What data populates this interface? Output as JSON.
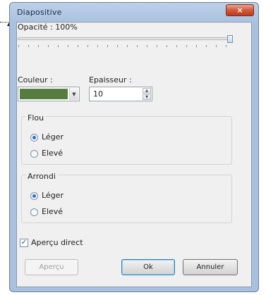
{
  "window": {
    "title": "Diapositive",
    "close_symbol": "×"
  },
  "opacity": {
    "label": "Opacité : 100%",
    "value_percent": 100
  },
  "color": {
    "label": "Couleur :",
    "value_hex": "#567d3f"
  },
  "thickness": {
    "label": "Epaisseur :",
    "value": "10"
  },
  "blur": {
    "legend": "Flou",
    "options": [
      "Léger",
      "Elevé"
    ],
    "selected": "Léger"
  },
  "rounding": {
    "legend": "Arrondi",
    "options": [
      "Léger",
      "Elevé"
    ],
    "selected": "Léger"
  },
  "live_preview": {
    "label": "Aperçu direct",
    "checked": true
  },
  "buttons": {
    "preview": "Aperçu",
    "ok": "Ok",
    "cancel": "Annuler"
  }
}
